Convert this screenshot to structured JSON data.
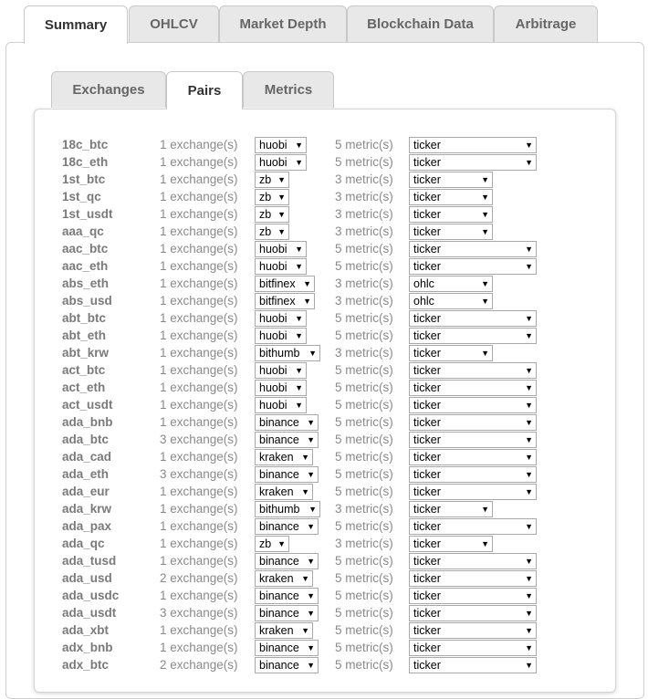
{
  "top_tabs": [
    "Summary",
    "OHLCV",
    "Market Depth",
    "Blockchain Data",
    "Arbitrage"
  ],
  "inner_tabs": [
    "Exchanges",
    "Pairs",
    "Metrics"
  ],
  "rows": [
    {
      "name": "18c_btc",
      "exchanges": "1 exchange(s)",
      "exchange": "huobi",
      "metrics": "5 metric(s)",
      "metric": "ticker"
    },
    {
      "name": "18c_eth",
      "exchanges": "1 exchange(s)",
      "exchange": "huobi",
      "metrics": "5 metric(s)",
      "metric": "ticker"
    },
    {
      "name": "1st_btc",
      "exchanges": "1 exchange(s)",
      "exchange": "zb",
      "metrics": "3 metric(s)",
      "metric": "ticker"
    },
    {
      "name": "1st_qc",
      "exchanges": "1 exchange(s)",
      "exchange": "zb",
      "metrics": "3 metric(s)",
      "metric": "ticker"
    },
    {
      "name": "1st_usdt",
      "exchanges": "1 exchange(s)",
      "exchange": "zb",
      "metrics": "3 metric(s)",
      "metric": "ticker"
    },
    {
      "name": "aaa_qc",
      "exchanges": "1 exchange(s)",
      "exchange": "zb",
      "metrics": "3 metric(s)",
      "metric": "ticker"
    },
    {
      "name": "aac_btc",
      "exchanges": "1 exchange(s)",
      "exchange": "huobi",
      "metrics": "5 metric(s)",
      "metric": "ticker"
    },
    {
      "name": "aac_eth",
      "exchanges": "1 exchange(s)",
      "exchange": "huobi",
      "metrics": "5 metric(s)",
      "metric": "ticker"
    },
    {
      "name": "abs_eth",
      "exchanges": "1 exchange(s)",
      "exchange": "bitfinex",
      "metrics": "3 metric(s)",
      "metric": "ohlc"
    },
    {
      "name": "abs_usd",
      "exchanges": "1 exchange(s)",
      "exchange": "bitfinex",
      "metrics": "3 metric(s)",
      "metric": "ohlc"
    },
    {
      "name": "abt_btc",
      "exchanges": "1 exchange(s)",
      "exchange": "huobi",
      "metrics": "5 metric(s)",
      "metric": "ticker"
    },
    {
      "name": "abt_eth",
      "exchanges": "1 exchange(s)",
      "exchange": "huobi",
      "metrics": "5 metric(s)",
      "metric": "ticker"
    },
    {
      "name": "abt_krw",
      "exchanges": "1 exchange(s)",
      "exchange": "bithumb",
      "metrics": "3 metric(s)",
      "metric": "ticker"
    },
    {
      "name": "act_btc",
      "exchanges": "1 exchange(s)",
      "exchange": "huobi",
      "metrics": "5 metric(s)",
      "metric": "ticker"
    },
    {
      "name": "act_eth",
      "exchanges": "1 exchange(s)",
      "exchange": "huobi",
      "metrics": "5 metric(s)",
      "metric": "ticker"
    },
    {
      "name": "act_usdt",
      "exchanges": "1 exchange(s)",
      "exchange": "huobi",
      "metrics": "5 metric(s)",
      "metric": "ticker"
    },
    {
      "name": "ada_bnb",
      "exchanges": "1 exchange(s)",
      "exchange": "binance",
      "metrics": "5 metric(s)",
      "metric": "ticker"
    },
    {
      "name": "ada_btc",
      "exchanges": "3 exchange(s)",
      "exchange": "binance",
      "metrics": "5 metric(s)",
      "metric": "ticker"
    },
    {
      "name": "ada_cad",
      "exchanges": "1 exchange(s)",
      "exchange": "kraken",
      "metrics": "5 metric(s)",
      "metric": "ticker"
    },
    {
      "name": "ada_eth",
      "exchanges": "3 exchange(s)",
      "exchange": "binance",
      "metrics": "5 metric(s)",
      "metric": "ticker"
    },
    {
      "name": "ada_eur",
      "exchanges": "1 exchange(s)",
      "exchange": "kraken",
      "metrics": "5 metric(s)",
      "metric": "ticker"
    },
    {
      "name": "ada_krw",
      "exchanges": "1 exchange(s)",
      "exchange": "bithumb",
      "metrics": "3 metric(s)",
      "metric": "ticker"
    },
    {
      "name": "ada_pax",
      "exchanges": "1 exchange(s)",
      "exchange": "binance",
      "metrics": "5 metric(s)",
      "metric": "ticker"
    },
    {
      "name": "ada_qc",
      "exchanges": "1 exchange(s)",
      "exchange": "zb",
      "metrics": "3 metric(s)",
      "metric": "ticker"
    },
    {
      "name": "ada_tusd",
      "exchanges": "1 exchange(s)",
      "exchange": "binance",
      "metrics": "5 metric(s)",
      "metric": "ticker"
    },
    {
      "name": "ada_usd",
      "exchanges": "2 exchange(s)",
      "exchange": "kraken",
      "metrics": "5 metric(s)",
      "metric": "ticker"
    },
    {
      "name": "ada_usdc",
      "exchanges": "1 exchange(s)",
      "exchange": "binance",
      "metrics": "5 metric(s)",
      "metric": "ticker"
    },
    {
      "name": "ada_usdt",
      "exchanges": "3 exchange(s)",
      "exchange": "binance",
      "metrics": "5 metric(s)",
      "metric": "ticker"
    },
    {
      "name": "ada_xbt",
      "exchanges": "1 exchange(s)",
      "exchange": "kraken",
      "metrics": "5 metric(s)",
      "metric": "ticker"
    },
    {
      "name": "adx_bnb",
      "exchanges": "1 exchange(s)",
      "exchange": "binance",
      "metrics": "5 metric(s)",
      "metric": "ticker"
    },
    {
      "name": "adx_btc",
      "exchanges": "2 exchange(s)",
      "exchange": "binance",
      "metrics": "5 metric(s)",
      "metric": "ticker"
    }
  ]
}
